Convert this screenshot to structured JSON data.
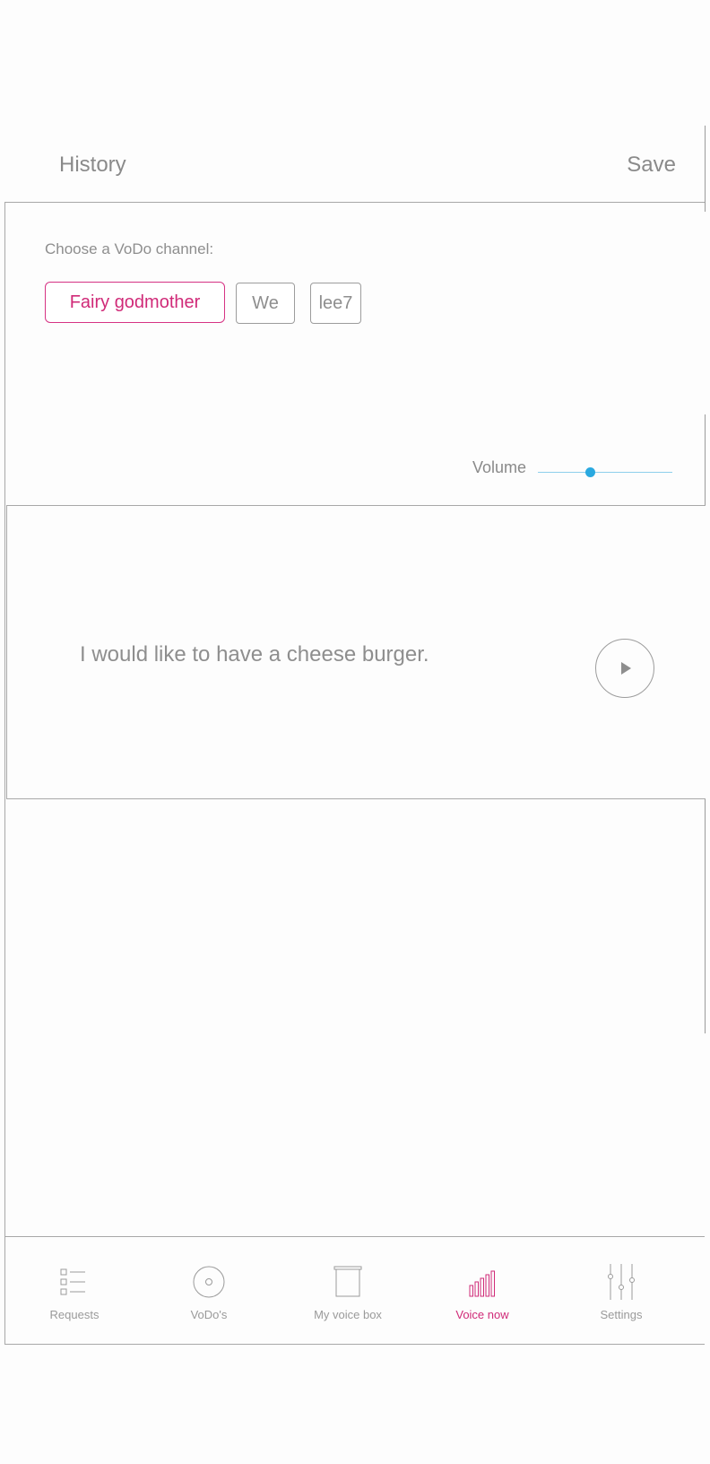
{
  "header": {
    "left_label": "History",
    "right_label": "Save"
  },
  "channel": {
    "prompt": "Choose a VoDo channel:",
    "options": [
      {
        "label": "Fairy godmother",
        "selected": true
      },
      {
        "label": "We",
        "selected": false
      },
      {
        "label": "lee7",
        "selected": false
      }
    ]
  },
  "volume": {
    "label": "Volume",
    "level": 0.39
  },
  "message": {
    "text": "I would like to have a cheese burger.",
    "play_icon": "play-icon"
  },
  "tabs": [
    {
      "label": "Requests",
      "icon": "list-icon",
      "active": false
    },
    {
      "label": "VoDo's",
      "icon": "disc-icon",
      "active": false
    },
    {
      "label": "My voice box",
      "icon": "box-icon",
      "active": false
    },
    {
      "label": "Voice now",
      "icon": "sound-bars-icon",
      "active": true
    },
    {
      "label": "Settings",
      "icon": "sliders-icon",
      "active": false
    }
  ],
  "colors": {
    "accent": "#d02a78",
    "slider": "#2aa9e0",
    "text": "#8e8e8e",
    "border": "#a8a8a8"
  }
}
